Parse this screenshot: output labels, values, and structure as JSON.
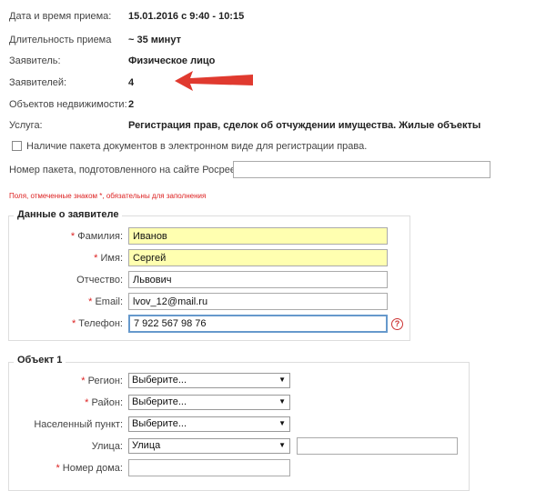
{
  "info": {
    "date_label": "Дата и время приема:",
    "date_value": "15.01.2016 с 9:40 - 10:15",
    "duration_label": "Длительность приема",
    "duration_value": "~ 35 минут",
    "applicant_label": "Заявитель:",
    "applicant_value": "Физическое лицо",
    "applicants_label": "Заявителей:",
    "applicants_value": "4",
    "objects_label": "Объектов недвижимости:",
    "objects_value": "2",
    "service_label": "Услуга:",
    "service_value": "Регистрация прав, сделок об отчуждении имущества. Жилые объекты"
  },
  "package": {
    "checkbox_label": "Наличие пакета документов в электронном виде для регистрации права.",
    "number_label": "Номер пакета, подготовленного на сайте Росреестра:",
    "number_value": ""
  },
  "required_note": "Поля, отмеченные знаком *, обязательны для заполнения",
  "applicant_section": {
    "legend": "Данные о заявителе",
    "req_mark": "*",
    "surname_label": "Фамилия:",
    "surname_value": "Иванов",
    "name_label": "Имя:",
    "name_value": "Сергей",
    "patronymic_label": "Отчество:",
    "patronymic_value": "Львович",
    "email_label": "Email:",
    "email_value": "lvov_12@mail.ru",
    "phone_label": "Телефон:",
    "phone_value": "7 922 567 98 76",
    "help_icon": "?"
  },
  "object_section": {
    "legend": "Объект 1",
    "region_label": "Регион:",
    "region_value": "Выберите...",
    "district_label": "Район:",
    "district_value": "Выберите...",
    "locality_label": "Населенный пункт:",
    "locality_value": "Выберите...",
    "street_label": "Улица:",
    "street_value": "Улица",
    "street_text": "",
    "house_label": "Номер дома:",
    "house_value": ""
  },
  "colors": {
    "arrow": "#e03a2f",
    "required": "#dd2222",
    "highlight_input": "#ffffb0"
  }
}
